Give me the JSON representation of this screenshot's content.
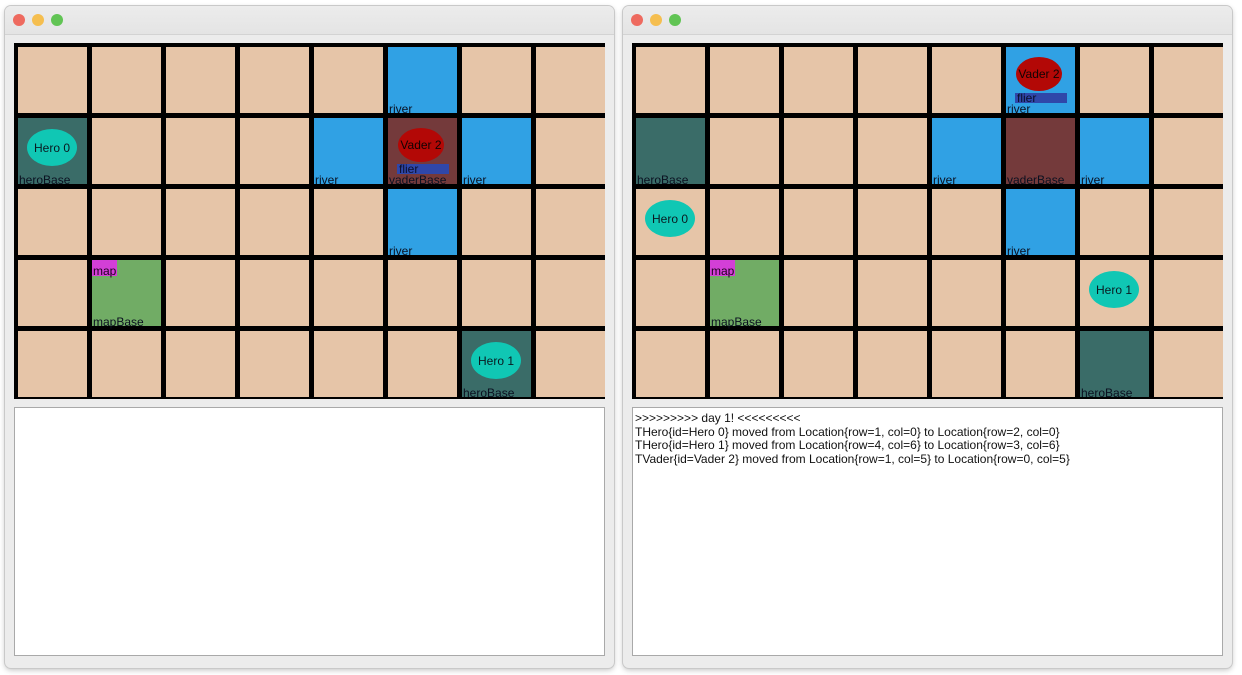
{
  "colors": {
    "grass": "#e6c5a8",
    "river": "#30a1e4",
    "heroBase": "#3a6c68",
    "vaderBase": "#743a3b",
    "mapBase": "#71ac65",
    "hero": "#10c7b4",
    "vader": "#b30806",
    "flier": "#2f47a9",
    "map": "#d33fd7",
    "grid": "#000000"
  },
  "windows": [
    {
      "id": "left",
      "board": {
        "rows": 5,
        "cols": 8,
        "terrain": [
          [
            "grass",
            "grass",
            "grass",
            "grass",
            "grass",
            "river",
            "grass",
            "grass"
          ],
          [
            "heroBase",
            "grass",
            "grass",
            "grass",
            "river",
            "vaderBase",
            "river",
            "grass"
          ],
          [
            "grass",
            "grass",
            "grass",
            "grass",
            "grass",
            "river",
            "grass",
            "grass"
          ],
          [
            "grass",
            "mapBase",
            "grass",
            "grass",
            "grass",
            "grass",
            "grass",
            "grass"
          ],
          [
            "grass",
            "grass",
            "grass",
            "grass",
            "grass",
            "grass",
            "heroBase",
            "grass"
          ]
        ],
        "heroes": [
          {
            "label": "Hero 0",
            "row": 1,
            "col": 0
          },
          {
            "label": "Hero 1",
            "row": 4,
            "col": 6
          }
        ],
        "vaders": [
          {
            "label": "Vader 2",
            "row": 1,
            "col": 5,
            "item": "flier"
          }
        ],
        "maps": [
          {
            "label": "map",
            "row": 3,
            "col": 1
          }
        ]
      },
      "log": []
    },
    {
      "id": "right",
      "board": {
        "rows": 5,
        "cols": 8,
        "terrain": [
          [
            "grass",
            "grass",
            "grass",
            "grass",
            "grass",
            "river",
            "grass",
            "grass"
          ],
          [
            "heroBase",
            "grass",
            "grass",
            "grass",
            "river",
            "vaderBase",
            "river",
            "grass"
          ],
          [
            "grass",
            "grass",
            "grass",
            "grass",
            "grass",
            "river",
            "grass",
            "grass"
          ],
          [
            "grass",
            "mapBase",
            "grass",
            "grass",
            "grass",
            "grass",
            "grass",
            "grass"
          ],
          [
            "grass",
            "grass",
            "grass",
            "grass",
            "grass",
            "grass",
            "heroBase",
            "grass"
          ]
        ],
        "heroes": [
          {
            "label": "Hero 0",
            "row": 2,
            "col": 0
          },
          {
            "label": "Hero 1",
            "row": 3,
            "col": 6
          }
        ],
        "vaders": [
          {
            "label": "Vader 2",
            "row": 0,
            "col": 5,
            "item": "flier"
          }
        ],
        "maps": [
          {
            "label": "map",
            "row": 3,
            "col": 1
          }
        ]
      },
      "log": [
        ">>>>>>>>> day 1! <<<<<<<<<",
        "THero{id=Hero 0} moved from Location{row=1, col=0} to Location{row=2, col=0}",
        "THero{id=Hero 1} moved from Location{row=4, col=6} to Location{row=3, col=6}",
        "TVader{id=Vader 2} moved from Location{row=1, col=5} to Location{row=0, col=5}"
      ]
    }
  ]
}
